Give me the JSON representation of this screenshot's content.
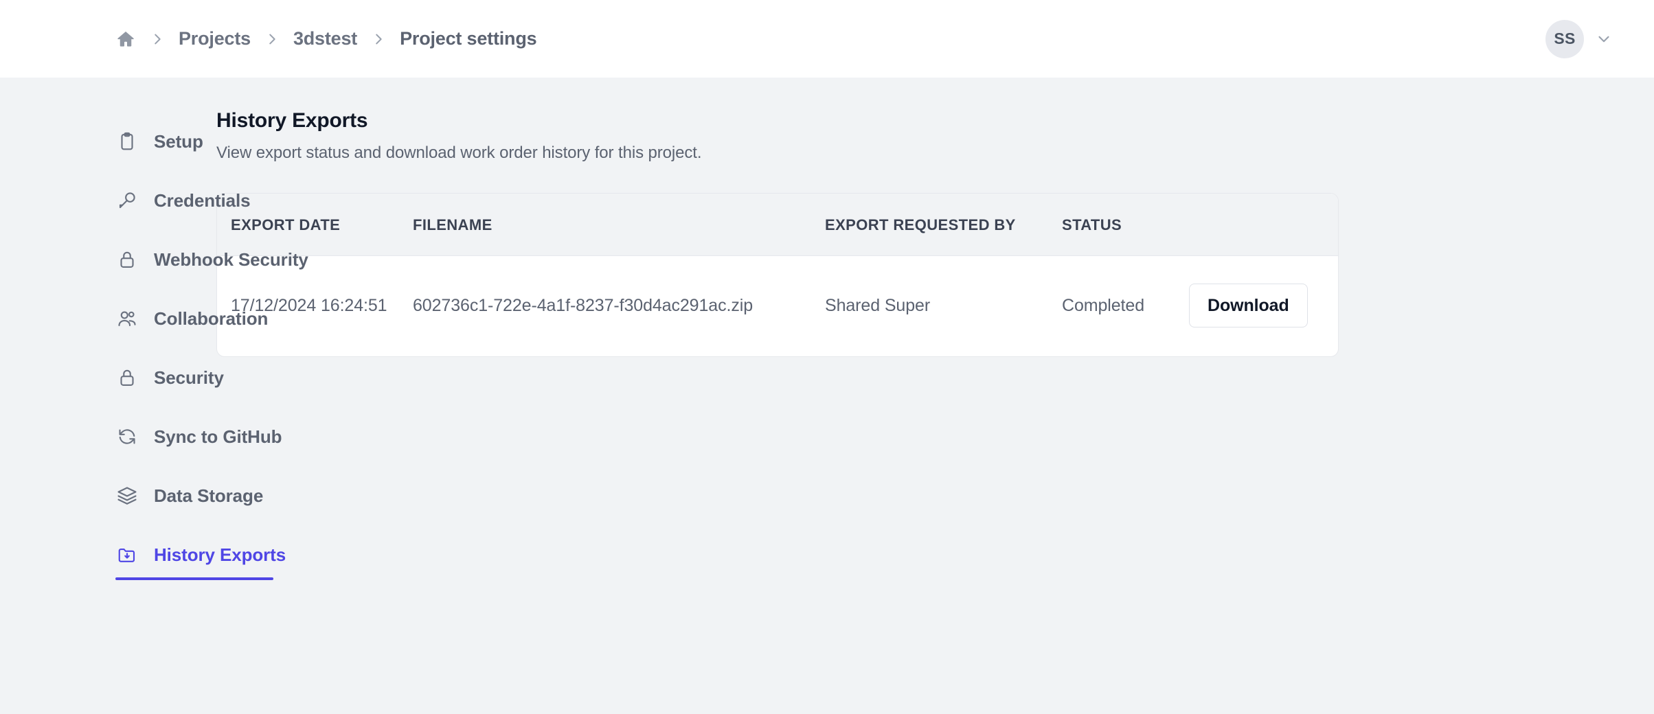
{
  "topbar": {
    "home_icon": "home-icon",
    "separator_icon": "chevron-right-icon",
    "breadcrumb": [
      {
        "label": "Projects"
      },
      {
        "label": "3dstest"
      },
      {
        "label": "Project settings"
      }
    ],
    "account": {
      "initials": "SS",
      "chevron_icon": "chevron-down-icon"
    }
  },
  "sidebar": {
    "items": [
      {
        "label": "Setup",
        "icon": "clipboard-icon",
        "active": false
      },
      {
        "label": "Credentials",
        "icon": "key-icon",
        "active": false
      },
      {
        "label": "Webhook Security",
        "icon": "lock-icon",
        "active": false
      },
      {
        "label": "Collaboration",
        "icon": "users-icon",
        "active": false
      },
      {
        "label": "Security",
        "icon": "lock-icon",
        "active": false
      },
      {
        "label": "Sync to GitHub",
        "icon": "refresh-icon",
        "active": false
      },
      {
        "label": "Data Storage",
        "icon": "layers-icon",
        "active": false
      },
      {
        "label": "History Exports",
        "icon": "folder-download-icon",
        "active": true
      }
    ]
  },
  "main": {
    "title": "History Exports",
    "subtitle": "View export status and download work order history for this project.",
    "table": {
      "columns": [
        "EXPORT DATE",
        "FILENAME",
        "EXPORT REQUESTED BY",
        "STATUS"
      ],
      "rows": [
        {
          "export_date": "17/12/2024 16:24:51",
          "filename": "602736c1-722e-4a1f-8237-f30d4ac291ac.zip",
          "requested_by": "Shared Super",
          "status": "Completed",
          "action_label": "Download"
        }
      ]
    }
  },
  "colors": {
    "accent": "#4f46e5",
    "page_bg": "#f1f3f5",
    "surface": "#ffffff",
    "text_muted": "#5b6270"
  }
}
